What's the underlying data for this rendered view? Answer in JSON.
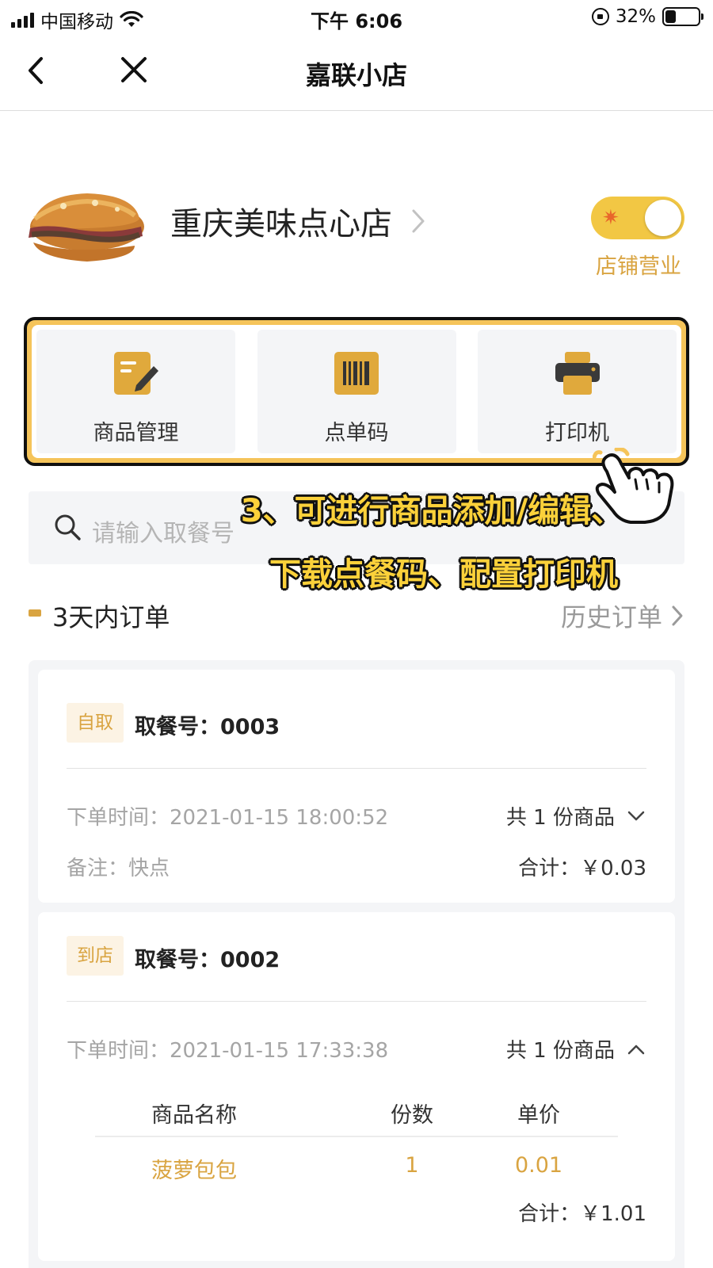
{
  "status_bar": {
    "carrier": "中国移动",
    "time": "下午 6:06",
    "battery_percent": "32%",
    "battery_level": 0.32
  },
  "nav": {
    "title": "嘉联小店"
  },
  "store": {
    "name": "重庆美味点心店",
    "status_label": "店铺营业",
    "open": true
  },
  "actions": [
    {
      "label": "商品管理",
      "icon": "edit-document-icon"
    },
    {
      "label": "点单码",
      "icon": "barcode-icon"
    },
    {
      "label": "打印机",
      "icon": "printer-icon"
    }
  ],
  "search": {
    "placeholder": "请输入取餐号"
  },
  "annotation": {
    "line1": "3、可进行商品添加/编辑、",
    "line2": "下载点餐码、配置打印机"
  },
  "orders_section": {
    "title": "3天内订单",
    "history_link": "历史订单"
  },
  "orders": [
    {
      "tag": "自取",
      "pickup_no": "取餐号：0003",
      "order_time": "下单时间：2021-01-15 18:00:52",
      "item_count": "共 1 份商品",
      "note": "备注：快点",
      "total": "合计：￥0.03",
      "expanded": false
    },
    {
      "tag": "到店",
      "pickup_no": "取餐号：0002",
      "order_time": "下单时间：2021-01-15 17:33:38",
      "item_count": "共 1 份商品",
      "expanded": true,
      "table_headers": [
        "商品名称",
        "份数",
        "单价"
      ],
      "items": [
        {
          "name": "菠萝包包",
          "qty": "1",
          "price": "0.01"
        }
      ],
      "total": "合计：￥1.01"
    }
  ],
  "colors": {
    "accent": "#d9a441",
    "toggle_on": "#f2c744",
    "annotation_text": "#fbd13a"
  }
}
